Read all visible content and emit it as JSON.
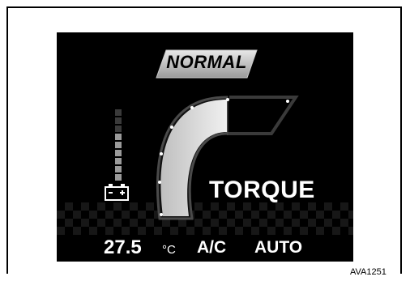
{
  "mode": {
    "label": "NORMAL"
  },
  "gauge": {
    "label": "TORQUE",
    "fill_fraction": 0.7
  },
  "battery": {
    "level_segments": 6,
    "total_segments": 9,
    "icon": "battery-icon"
  },
  "climate": {
    "temperature": "27.5",
    "unit": "°C",
    "ac": "A/C",
    "mode": "AUTO"
  },
  "figure": {
    "code": "AVA1251"
  },
  "colors": {
    "screen": "#000000",
    "badge": "#bdbdbd",
    "gauge_fill": "#d9d9d9",
    "text": "#ffffff"
  }
}
